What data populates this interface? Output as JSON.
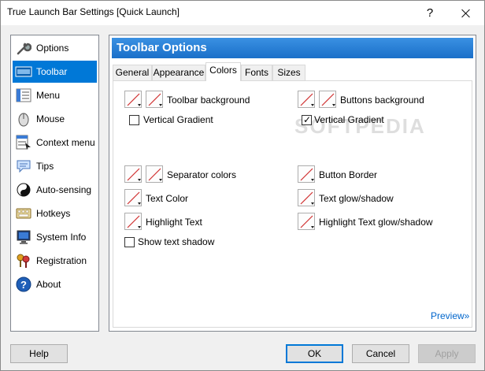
{
  "window": {
    "title": "True Launch Bar Settings [Quick Launch]",
    "help_glyph": "?"
  },
  "sidebar": {
    "items": [
      {
        "label": "Options",
        "icon": "wrench-icon"
      },
      {
        "label": "Toolbar",
        "icon": "toolbar-icon",
        "selected": true
      },
      {
        "label": "Menu",
        "icon": "menu-icon"
      },
      {
        "label": "Mouse",
        "icon": "mouse-icon"
      },
      {
        "label": "Context menu",
        "icon": "context-menu-icon"
      },
      {
        "label": "Tips",
        "icon": "speech-bubble-icon"
      },
      {
        "label": "Auto-sensing",
        "icon": "yin-yang-icon"
      },
      {
        "label": "Hotkeys",
        "icon": "keyboard-icon"
      },
      {
        "label": "System Info",
        "icon": "monitor-icon"
      },
      {
        "label": "Registration",
        "icon": "keys-icon"
      },
      {
        "label": "About",
        "icon": "help-icon"
      }
    ]
  },
  "panel": {
    "header": "Toolbar Options",
    "tabs": [
      "General",
      "Appearance",
      "Colors",
      "Fonts",
      "Sizes"
    ],
    "active_tab": "Colors",
    "left": {
      "toolbar_background": "Toolbar background",
      "vertical_gradient": "Vertical Gradient",
      "separator_colors": "Separator colors",
      "text_color": "Text Color",
      "highlight_text": "Highlight Text",
      "show_text_shadow": "Show text shadow"
    },
    "right": {
      "buttons_background": "Buttons background",
      "vertical_gradient": "Vertical Gradient",
      "button_border": "Button Border",
      "text_glow_shadow": "Text glow/shadow",
      "highlight_text_glow_shadow": "Highlight Text glow/shadow"
    },
    "checkboxes": {
      "left_vertical_gradient": false,
      "right_vertical_gradient": true,
      "show_text_shadow": false
    },
    "preview_link": "Preview»",
    "watermark": "SOFTPEDIA"
  },
  "buttons": {
    "help": "Help",
    "ok": "OK",
    "cancel": "Cancel",
    "apply": "Apply"
  },
  "colors": {
    "accent": "#0078d7",
    "header_gradient_top": "#3a91e3",
    "header_gradient_bottom": "#1a6fc9",
    "link": "#0066cc"
  }
}
